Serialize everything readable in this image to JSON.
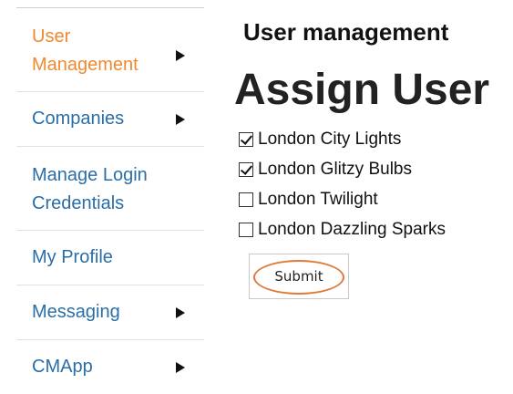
{
  "sidebar": {
    "items": [
      {
        "label": "User Management",
        "has_submenu": true,
        "active": true
      },
      {
        "label": "Companies",
        "has_submenu": true,
        "active": false
      },
      {
        "label": "Manage Login Credentials",
        "has_submenu": false,
        "active": false
      },
      {
        "label": "My Profile",
        "has_submenu": false,
        "active": false
      },
      {
        "label": "Messaging",
        "has_submenu": true,
        "active": false
      },
      {
        "label": "CMApp",
        "has_submenu": true,
        "active": false
      }
    ]
  },
  "main": {
    "section_title": "User management",
    "page_title": "Assign User",
    "options": [
      {
        "label": "London City Lights",
        "checked": true
      },
      {
        "label": "London Glitzy Bulbs",
        "checked": true
      },
      {
        "label": "London Twilight",
        "checked": false
      },
      {
        "label": "London Dazzling Sparks",
        "checked": false
      }
    ],
    "submit_label": "Submit"
  },
  "colors": {
    "link": "#2a6ea8",
    "active_link": "#f0892e",
    "highlight_ring": "#e07a3a"
  },
  "icons": {
    "submenu_arrow": "triangle-right-icon",
    "checkbox_check": "check-icon"
  }
}
